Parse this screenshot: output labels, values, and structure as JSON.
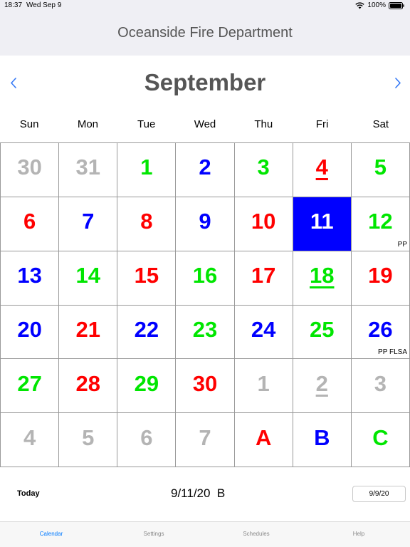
{
  "status_bar": {
    "time": "18:37",
    "date": "Wed Sep 9",
    "battery": "100%"
  },
  "nav": {
    "title": "Oceanside Fire Department"
  },
  "calendar": {
    "month": "September",
    "weekdays": [
      "Sun",
      "Mon",
      "Tue",
      "Wed",
      "Thu",
      "Fri",
      "Sat"
    ],
    "colors": {
      "red": "#ff0000",
      "blue": "#0000ff",
      "green": "#00e600",
      "gray": "#b4b4b4",
      "white": "#ffffff",
      "selected_bg": "#0000ff"
    },
    "cells": [
      {
        "day": "30",
        "color": "gray"
      },
      {
        "day": "31",
        "color": "gray"
      },
      {
        "day": "1",
        "color": "green"
      },
      {
        "day": "2",
        "color": "blue"
      },
      {
        "day": "3",
        "color": "green"
      },
      {
        "day": "4",
        "color": "red",
        "underline": true
      },
      {
        "day": "5",
        "color": "green"
      },
      {
        "day": "6",
        "color": "red"
      },
      {
        "day": "7",
        "color": "blue"
      },
      {
        "day": "8",
        "color": "red"
      },
      {
        "day": "9",
        "color": "blue"
      },
      {
        "day": "10",
        "color": "red"
      },
      {
        "day": "11",
        "color": "white",
        "selected": true
      },
      {
        "day": "12",
        "color": "green",
        "note": "PP"
      },
      {
        "day": "13",
        "color": "blue"
      },
      {
        "day": "14",
        "color": "green"
      },
      {
        "day": "15",
        "color": "red"
      },
      {
        "day": "16",
        "color": "green"
      },
      {
        "day": "17",
        "color": "red"
      },
      {
        "day": "18",
        "color": "green",
        "underline": true
      },
      {
        "day": "19",
        "color": "red"
      },
      {
        "day": "20",
        "color": "blue"
      },
      {
        "day": "21",
        "color": "red"
      },
      {
        "day": "22",
        "color": "blue"
      },
      {
        "day": "23",
        "color": "green"
      },
      {
        "day": "24",
        "color": "blue"
      },
      {
        "day": "25",
        "color": "green"
      },
      {
        "day": "26",
        "color": "blue",
        "note": "PP FLSA"
      },
      {
        "day": "27",
        "color": "green"
      },
      {
        "day": "28",
        "color": "red"
      },
      {
        "day": "29",
        "color": "green"
      },
      {
        "day": "30",
        "color": "red"
      },
      {
        "day": "1",
        "color": "gray"
      },
      {
        "day": "2",
        "color": "gray",
        "underline": true
      },
      {
        "day": "3",
        "color": "gray"
      },
      {
        "day": "4",
        "color": "gray"
      },
      {
        "day": "5",
        "color": "gray"
      },
      {
        "day": "6",
        "color": "gray"
      },
      {
        "day": "7",
        "color": "gray"
      },
      {
        "day": "A",
        "color": "red"
      },
      {
        "day": "B",
        "color": "blue"
      },
      {
        "day": "C",
        "color": "green"
      }
    ]
  },
  "footer": {
    "today_label": "Today",
    "selected_date": "9/11/20",
    "selected_shift": "B",
    "date_field": "9/9/20"
  },
  "tabs": [
    {
      "label": "Calendar",
      "active": true
    },
    {
      "label": "Settings",
      "active": false
    },
    {
      "label": "Schedules",
      "active": false
    },
    {
      "label": "Help",
      "active": false
    }
  ]
}
